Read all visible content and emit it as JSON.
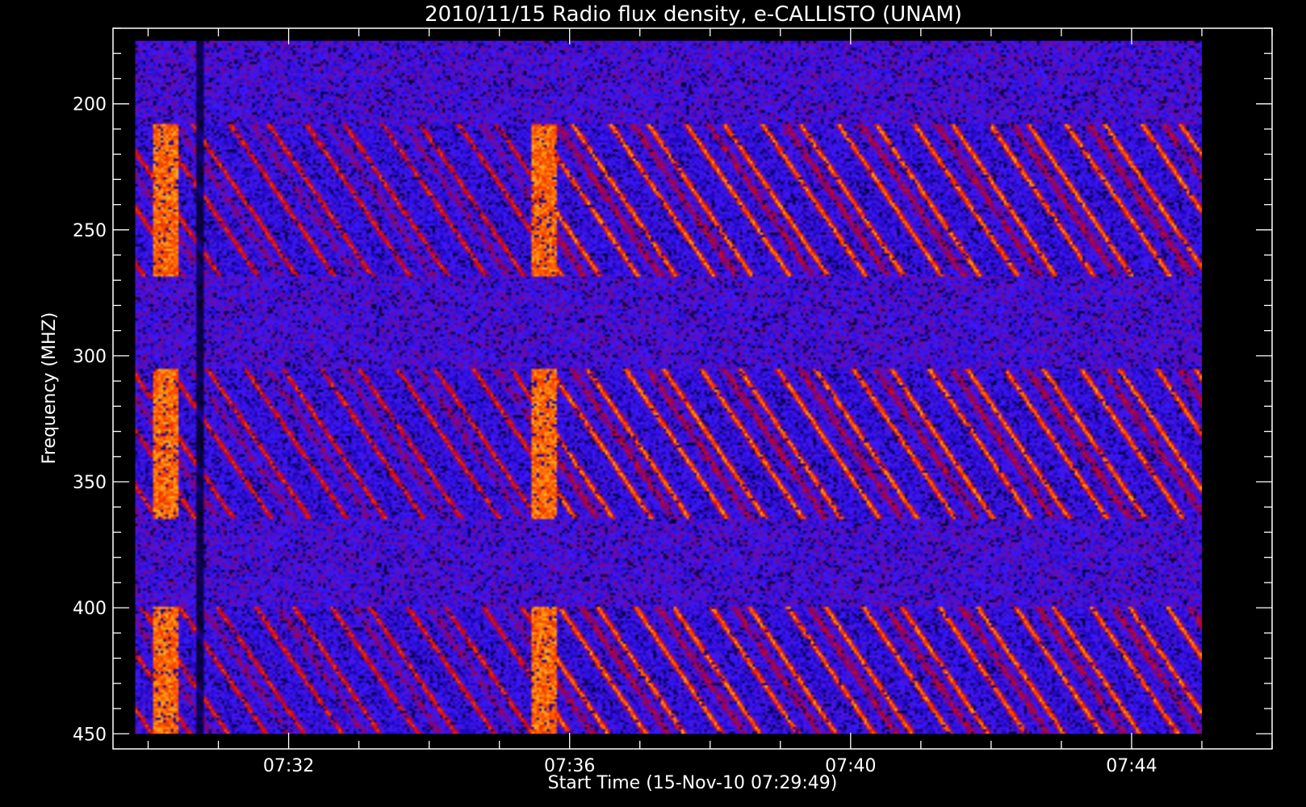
{
  "chart_data": {
    "type": "heatmap",
    "title": "2010/11/15  Radio flux density, e-CALLISTO (UNAM)",
    "xlabel": "Start Time (15-Nov-10 07:29:49)",
    "ylabel": "Frequency (MHZ)",
    "x_axis": {
      "unit": "time",
      "range": [
        "07:29:30",
        "07:46:00"
      ],
      "data_range": [
        "07:29:49",
        "07:45:00"
      ],
      "major_ticks": [
        "07:32",
        "07:36",
        "07:40",
        "07:44"
      ],
      "minor_tick_interval_min": 1
    },
    "y_axis": {
      "unit": "MHz",
      "range": [
        170,
        456
      ],
      "data_range": [
        175,
        450
      ],
      "reversed": true,
      "major_ticks": [
        200,
        250,
        300,
        350,
        400,
        450
      ],
      "minor_tick_interval": 10
    },
    "colormap": [
      "#000000",
      "#1a00a0",
      "#3a1aff",
      "#8a0066",
      "#e01000",
      "#ff6600",
      "#ffdd33"
    ],
    "features": {
      "bright_columns_min": [
        0.4,
        5.8
      ],
      "dark_column_min": 0.9,
      "quiet_bands_mhz": [
        [
          175,
          208
        ],
        [
          268,
          305
        ],
        [
          365,
          400
        ]
      ]
    },
    "grid": false,
    "legend": "none"
  }
}
